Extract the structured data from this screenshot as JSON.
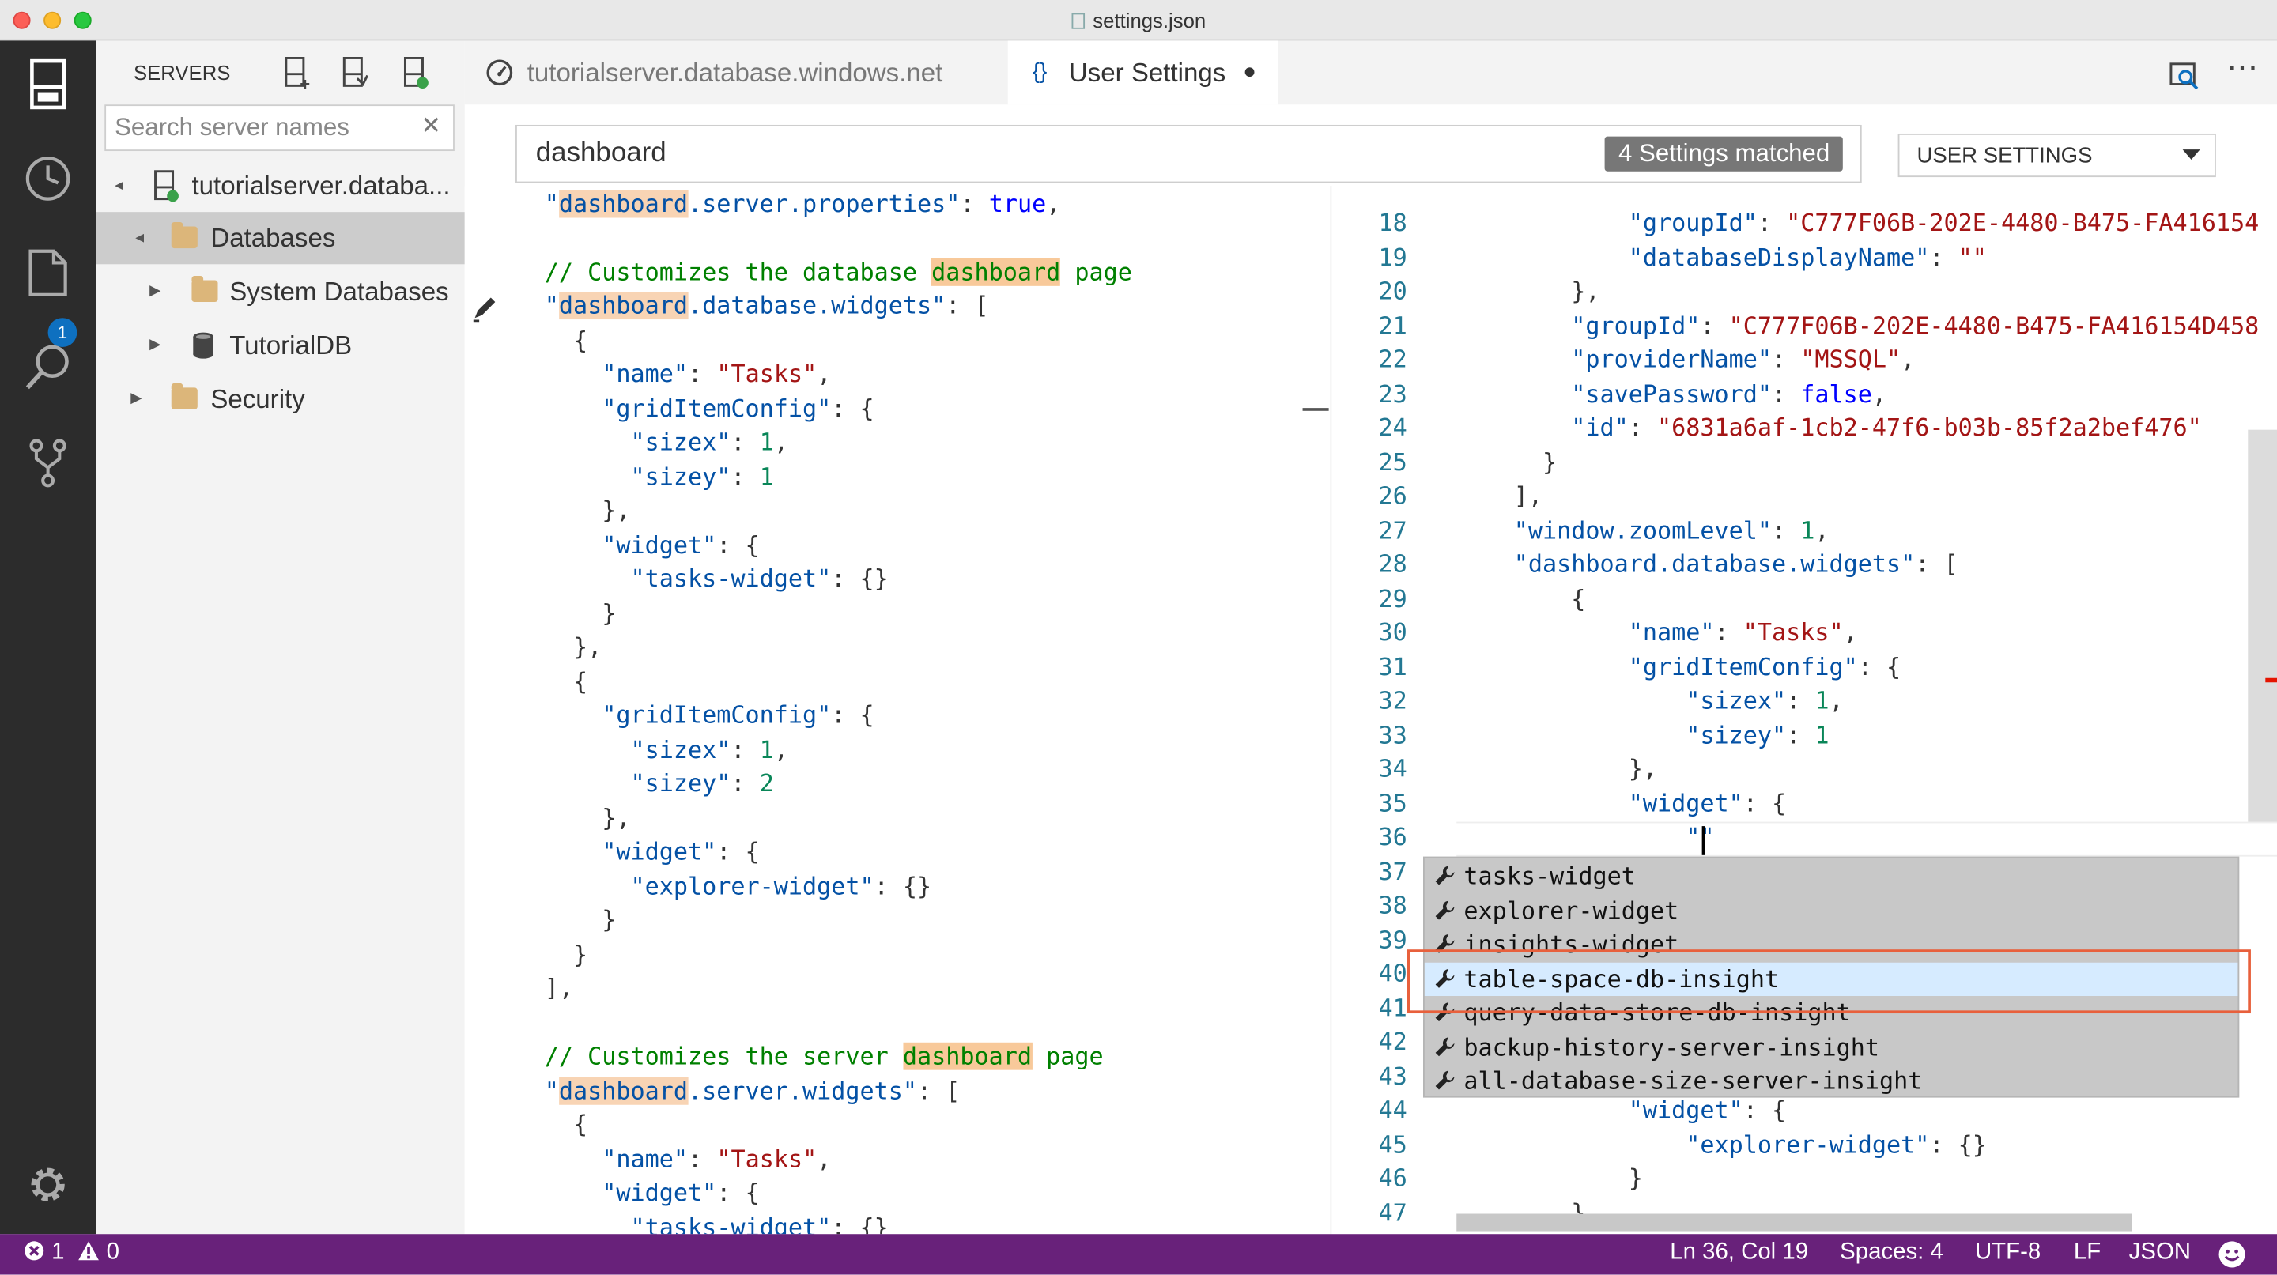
{
  "window": {
    "title": "settings.json"
  },
  "colors": {
    "statusbar": "#68217a",
    "activity_bar": "#2c2c2c",
    "highlight_box": "#e8603c",
    "badge": "#0e70c0"
  },
  "activity_bar": {
    "icons": [
      "servers-icon",
      "history-icon",
      "explorer-icon",
      "search-icon",
      "source-control-icon",
      "settings-gear-icon"
    ],
    "explorer_badge": "1"
  },
  "sidebar": {
    "title": "SERVERS",
    "search_placeholder": "Search server names",
    "clear_glyph": "✕",
    "tree": [
      {
        "label": "tutorialserver.databa...",
        "twisty": "▲"
      },
      {
        "label": "Databases",
        "twisty": "▲"
      },
      {
        "label": "System Databases",
        "twisty": "▶"
      },
      {
        "label": "TutorialDB",
        "twisty": "▶"
      },
      {
        "label": "Security",
        "twisty": "▶"
      }
    ]
  },
  "tabs": [
    {
      "label": "tutorialserver.database.windows.net"
    },
    {
      "label": "User Settings",
      "icon_text": "{}",
      "dirty": "●"
    }
  ],
  "settings_search": {
    "value": "dashboard",
    "matched": "4 Settings matched"
  },
  "scope_select": {
    "label": "USER SETTINGS"
  },
  "left_editor": {
    "lines": [
      [
        {
          "t": "\"",
          "c": "k"
        },
        {
          "t": "dashboard",
          "c": "k hl"
        },
        {
          "t": ".server.properties\"",
          "c": "k"
        },
        {
          "t": ": ",
          "c": "p"
        },
        {
          "t": "true",
          "c": "b"
        },
        {
          "t": ",",
          "c": "p"
        }
      ],
      [],
      [
        {
          "t": "// Customizes the database ",
          "c": "c"
        },
        {
          "t": "dashboard",
          "c": "c hlg"
        },
        {
          "t": " page",
          "c": "c"
        }
      ],
      [
        {
          "t": "\"",
          "c": "k"
        },
        {
          "t": "dashboard",
          "c": "k hl"
        },
        {
          "t": ".database.widgets\"",
          "c": "k"
        },
        {
          "t": ": [",
          "c": "p"
        }
      ],
      [
        {
          "t": "  {",
          "c": "p"
        }
      ],
      [
        {
          "t": "    \"name\"",
          "c": "k"
        },
        {
          "t": ": ",
          "c": "p"
        },
        {
          "t": "\"Tasks\"",
          "c": "s"
        },
        {
          "t": ",",
          "c": "p"
        }
      ],
      [
        {
          "t": "    \"gridItemConfig\"",
          "c": "k"
        },
        {
          "t": ": {",
          "c": "p"
        }
      ],
      [
        {
          "t": "      \"sizex\"",
          "c": "k"
        },
        {
          "t": ": ",
          "c": "p"
        },
        {
          "t": "1",
          "c": "n"
        },
        {
          "t": ",",
          "c": "p"
        }
      ],
      [
        {
          "t": "      \"sizey\"",
          "c": "k"
        },
        {
          "t": ": ",
          "c": "p"
        },
        {
          "t": "1",
          "c": "n"
        }
      ],
      [
        {
          "t": "    },",
          "c": "p"
        }
      ],
      [
        {
          "t": "    \"widget\"",
          "c": "k"
        },
        {
          "t": ": {",
          "c": "p"
        }
      ],
      [
        {
          "t": "      \"tasks-widget\"",
          "c": "k"
        },
        {
          "t": ": {}",
          "c": "p"
        }
      ],
      [
        {
          "t": "    }",
          "c": "p"
        }
      ],
      [
        {
          "t": "  },",
          "c": "p"
        }
      ],
      [
        {
          "t": "  {",
          "c": "p"
        }
      ],
      [
        {
          "t": "    \"gridItemConfig\"",
          "c": "k"
        },
        {
          "t": ": {",
          "c": "p"
        }
      ],
      [
        {
          "t": "      \"sizex\"",
          "c": "k"
        },
        {
          "t": ": ",
          "c": "p"
        },
        {
          "t": "1",
          "c": "n"
        },
        {
          "t": ",",
          "c": "p"
        }
      ],
      [
        {
          "t": "      \"sizey\"",
          "c": "k"
        },
        {
          "t": ": ",
          "c": "p"
        },
        {
          "t": "2",
          "c": "n"
        }
      ],
      [
        {
          "t": "    },",
          "c": "p"
        }
      ],
      [
        {
          "t": "    \"widget\"",
          "c": "k"
        },
        {
          "t": ": {",
          "c": "p"
        }
      ],
      [
        {
          "t": "      \"explorer-widget\"",
          "c": "k"
        },
        {
          "t": ": {}",
          "c": "p"
        }
      ],
      [
        {
          "t": "    }",
          "c": "p"
        }
      ],
      [
        {
          "t": "  }",
          "c": "p"
        }
      ],
      [
        {
          "t": "],",
          "c": "p"
        }
      ],
      [],
      [
        {
          "t": "// Customizes the server ",
          "c": "c"
        },
        {
          "t": "dashboard",
          "c": "c hlg"
        },
        {
          "t": " page",
          "c": "c"
        }
      ],
      [
        {
          "t": "\"",
          "c": "k"
        },
        {
          "t": "dashboard",
          "c": "k hl"
        },
        {
          "t": ".server.widgets\"",
          "c": "k"
        },
        {
          "t": ": [",
          "c": "p"
        }
      ],
      [
        {
          "t": "  {",
          "c": "p"
        }
      ],
      [
        {
          "t": "    \"name\"",
          "c": "k"
        },
        {
          "t": ": ",
          "c": "p"
        },
        {
          "t": "\"Tasks\"",
          "c": "s"
        },
        {
          "t": ",",
          "c": "p"
        }
      ],
      [
        {
          "t": "    \"widget\"",
          "c": "k"
        },
        {
          "t": ": {",
          "c": "p"
        }
      ],
      [
        {
          "t": "      \"tasks-widget\"",
          "c": "k"
        },
        {
          "t": ": {}",
          "c": "p"
        }
      ]
    ]
  },
  "right_editor": {
    "lines": [
      {
        "n": "18",
        "seg": [
          {
            "t": "            \"groupId\"",
            "c": "k"
          },
          {
            "t": ": ",
            "c": "p"
          },
          {
            "t": "\"C777F06B-202E-4480-B475-FA416154",
            "c": "s"
          }
        ]
      },
      {
        "n": "19",
        "seg": [
          {
            "t": "            \"databaseDisplayName\"",
            "c": "k"
          },
          {
            "t": ": ",
            "c": "p"
          },
          {
            "t": "\"\"",
            "c": "s"
          }
        ]
      },
      {
        "n": "20",
        "seg": [
          {
            "t": "        },",
            "c": "p"
          }
        ]
      },
      {
        "n": "21",
        "seg": [
          {
            "t": "        \"groupId\"",
            "c": "k"
          },
          {
            "t": ": ",
            "c": "p"
          },
          {
            "t": "\"C777F06B-202E-4480-B475-FA416154D458",
            "c": "s"
          }
        ]
      },
      {
        "n": "22",
        "seg": [
          {
            "t": "        \"providerName\"",
            "c": "k"
          },
          {
            "t": ": ",
            "c": "p"
          },
          {
            "t": "\"MSSQL\"",
            "c": "s"
          },
          {
            "t": ",",
            "c": "p"
          }
        ]
      },
      {
        "n": "23",
        "seg": [
          {
            "t": "        \"savePassword\"",
            "c": "k"
          },
          {
            "t": ": ",
            "c": "p"
          },
          {
            "t": "false",
            "c": "b"
          },
          {
            "t": ",",
            "c": "p"
          }
        ]
      },
      {
        "n": "24",
        "seg": [
          {
            "t": "        \"id\"",
            "c": "k"
          },
          {
            "t": ": ",
            "c": "p"
          },
          {
            "t": "\"6831a6af-1cb2-47f6-b03b-85f2a2bef476\"",
            "c": "s"
          }
        ]
      },
      {
        "n": "25",
        "seg": [
          {
            "t": "      }",
            "c": "p"
          }
        ]
      },
      {
        "n": "26",
        "seg": [
          {
            "t": "    ],",
            "c": "p"
          }
        ]
      },
      {
        "n": "27",
        "seg": [
          {
            "t": "    \"window.zoomLevel\"",
            "c": "k"
          },
          {
            "t": ": ",
            "c": "p"
          },
          {
            "t": "1",
            "c": "n"
          },
          {
            "t": ",",
            "c": "p"
          }
        ]
      },
      {
        "n": "28",
        "seg": [
          {
            "t": "    \"dashboard.database.widgets\"",
            "c": "k"
          },
          {
            "t": ": [",
            "c": "p"
          }
        ]
      },
      {
        "n": "29",
        "seg": [
          {
            "t": "        {",
            "c": "p"
          }
        ]
      },
      {
        "n": "30",
        "seg": [
          {
            "t": "            \"name\"",
            "c": "k"
          },
          {
            "t": ": ",
            "c": "p"
          },
          {
            "t": "\"Tasks\"",
            "c": "s"
          },
          {
            "t": ",",
            "c": "p"
          }
        ]
      },
      {
        "n": "31",
        "seg": [
          {
            "t": "            \"gridItemConfig\"",
            "c": "k"
          },
          {
            "t": ": {",
            "c": "p"
          }
        ]
      },
      {
        "n": "32",
        "seg": [
          {
            "t": "                \"sizex\"",
            "c": "k"
          },
          {
            "t": ": ",
            "c": "p"
          },
          {
            "t": "1",
            "c": "n"
          },
          {
            "t": ",",
            "c": "p"
          }
        ]
      },
      {
        "n": "33",
        "seg": [
          {
            "t": "                \"sizey\"",
            "c": "k"
          },
          {
            "t": ": ",
            "c": "p"
          },
          {
            "t": "1",
            "c": "n"
          }
        ]
      },
      {
        "n": "34",
        "seg": [
          {
            "t": "            },",
            "c": "p"
          }
        ]
      },
      {
        "n": "35",
        "seg": [
          {
            "t": "            \"widget\"",
            "c": "k"
          },
          {
            "t": ": {",
            "c": "p"
          }
        ]
      },
      {
        "n": "36",
        "seg": [
          {
            "t": "                \"\"",
            "c": "k"
          }
        ]
      },
      {
        "n": "37",
        "seg": []
      },
      {
        "n": "38",
        "seg": []
      },
      {
        "n": "39",
        "seg": []
      },
      {
        "n": "40",
        "seg": []
      },
      {
        "n": "41",
        "seg": []
      },
      {
        "n": "42",
        "seg": []
      },
      {
        "n": "43",
        "seg": []
      },
      {
        "n": "44",
        "seg": [
          {
            "t": "            \"widget\"",
            "c": "k"
          },
          {
            "t": ": {",
            "c": "p"
          }
        ]
      },
      {
        "n": "45",
        "seg": [
          {
            "t": "                \"explorer-widget\"",
            "c": "k"
          },
          {
            "t": ": {}",
            "c": "p"
          }
        ]
      },
      {
        "n": "46",
        "seg": [
          {
            "t": "            }",
            "c": "p"
          }
        ]
      },
      {
        "n": "47",
        "seg": [
          {
            "t": "        }",
            "c": "p"
          }
        ]
      }
    ]
  },
  "suggestions": [
    "tasks-widget",
    "explorer-widget",
    "insights-widget",
    "table-space-db-insight",
    "query-data-store-db-insight",
    "backup-history-server-insight",
    "all-database-size-server-insight"
  ],
  "suggestion_selected": "table-space-db-insight",
  "statusbar": {
    "errors": "1",
    "warnings": "0",
    "position": "Ln 36, Col 19",
    "spaces": "Spaces: 4",
    "encoding": "UTF-8",
    "eol": "LF",
    "language": "JSON"
  }
}
